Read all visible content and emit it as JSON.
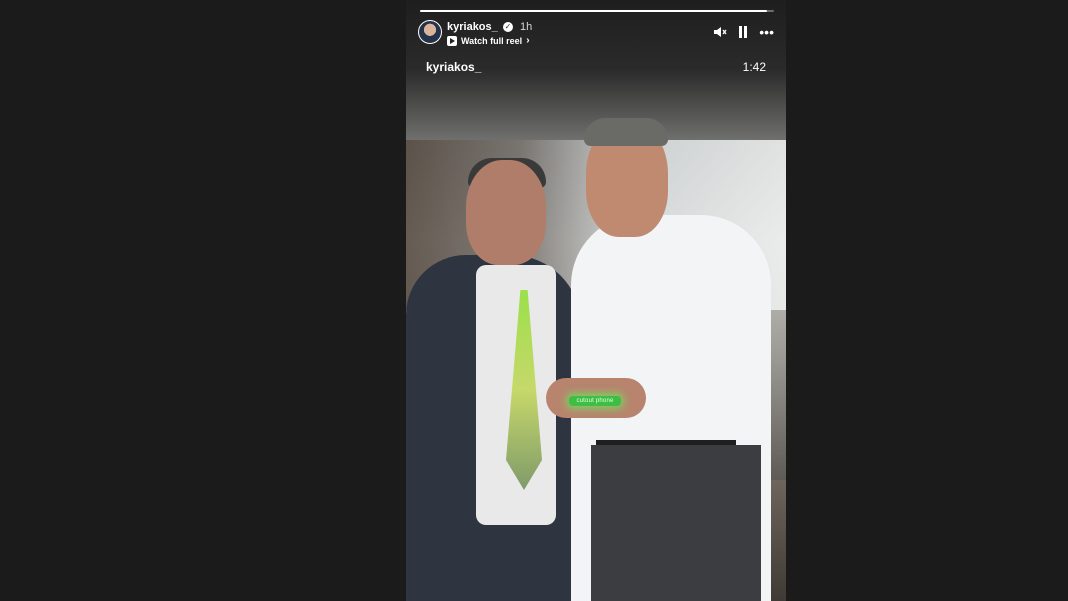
{
  "story": {
    "username": "kyriakos_",
    "verified_icon": "verified-badge-icon",
    "time_ago": "1h",
    "watch_reel_label": "Watch full reel",
    "progress": 0.98,
    "controls": {
      "mute_icon": "speaker-muted-icon",
      "pause_icon": "pause-icon",
      "more_icon": "more-options-icon"
    }
  },
  "reel": {
    "username": "kyriakos_",
    "duration": "1:42",
    "sticker_text": "cutout phone"
  },
  "colors": {
    "background": "#1b1b1b",
    "sticker_glow": "#5aff5a"
  }
}
